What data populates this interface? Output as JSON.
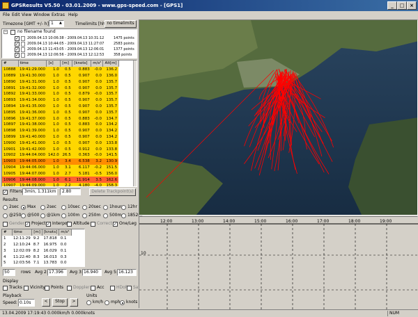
{
  "window": {
    "title": "GPSResults V5.50 - 03.01.2009 - www.gps-speed.com - [GPS1]",
    "min": "_",
    "max": "□",
    "close": "×"
  },
  "menubar": [
    "File",
    "Edit",
    "View",
    "Window",
    "Extras",
    "Help"
  ],
  "timezone": {
    "label": "Timezone [GMT +/- h]:",
    "value": "1",
    "timelimits_label": "Timelimits [hhmm]",
    "timelimits_button": "no timelimits"
  },
  "tracks": {
    "root": "no filename found",
    "items": [
      {
        "label": "2009.04.13 10:06:38 - 2009.04.13 10:31:12",
        "points": "1475 points"
      },
      {
        "label": "2009.04.13 10:44:05 - 2009.04.13 11:27:07",
        "points": "2583 points"
      },
      {
        "label": "2009.04.13 11:43:05 - 2009.04.13 12:06:01",
        "points": "1377 points"
      },
      {
        "label": "2009.04.13 12:06:56 - 2009.04.13 12:12:53",
        "points": "358 points"
      }
    ]
  },
  "points_table": {
    "headers": [
      "#",
      "time",
      "[s]",
      "[m]",
      "[knots]",
      "m/s²",
      "Alt[m]"
    ],
    "rows": [
      [
        "10888",
        "19:41:29.000",
        "1.0",
        "0.5",
        "0.883",
        "-0.0",
        "136.2"
      ],
      [
        "10889",
        "19:41:30.000",
        "1.0",
        "0.5",
        "0.907",
        "0.0",
        "136.0"
      ],
      [
        "10890",
        "19:41:31.000",
        "1.0",
        "0.5",
        "0.907",
        "0.0",
        "135.7"
      ],
      [
        "10891",
        "19:41:32.000",
        "1.0",
        "0.5",
        "0.907",
        "0.0",
        "135.7"
      ],
      [
        "10892",
        "19:41:33.000",
        "1.0",
        "0.5",
        "0.879",
        "-0.0",
        "135.7"
      ],
      [
        "10893",
        "19:41:34.000",
        "1.0",
        "0.5",
        "0.907",
        "0.0",
        "135.7"
      ],
      [
        "10894",
        "19:41:35.000",
        "1.0",
        "0.5",
        "0.907",
        "0.0",
        "135.7"
      ],
      [
        "10895",
        "19:41:36.000",
        "1.0",
        "0.5",
        "0.907",
        "0.0",
        "135.7"
      ],
      [
        "10896",
        "19:41:37.000",
        "1.0",
        "0.5",
        "0.883",
        "-0.0",
        "134.7"
      ],
      [
        "10897",
        "19:41:38.000",
        "1.0",
        "0.5",
        "0.883",
        "0.0",
        "134.2"
      ],
      [
        "10898",
        "19:41:39.000",
        "1.0",
        "0.5",
        "0.907",
        "0.0",
        "134.2"
      ],
      [
        "10899",
        "19:41:40.000",
        "1.0",
        "0.5",
        "0.907",
        "0.0",
        "134.2"
      ],
      [
        "10900",
        "19:41:41.000",
        "1.0",
        "0.5",
        "0.907",
        "0.0",
        "133.8"
      ],
      [
        "10901",
        "19:41:42.000",
        "1.0",
        "0.5",
        "0.912",
        "0.0",
        "133.8"
      ],
      [
        "10902",
        "19:44:04.000",
        "142.0",
        "26.5",
        "0.363",
        "-0.0",
        "141.5"
      ],
      [
        "10903",
        "19:44:05.000",
        "1.0",
        "3.4",
        "6.538",
        "3.2",
        "130.9"
      ],
      [
        "10904",
        "19:44:06.000",
        "1.0",
        "3.1",
        "6.117",
        "-0.2",
        "151.5"
      ],
      [
        "10905",
        "19:44:07.000",
        "1.0",
        "2.7",
        "5.181",
        "-0.5",
        "156.0"
      ],
      [
        "10906",
        "19:44:08.000",
        "1.0",
        "6.1",
        "11.914",
        "3.5",
        "162.6"
      ],
      [
        "10907",
        "19:44:09.000",
        "1.0",
        "2.2",
        "4.180",
        "-4.0",
        "158.3"
      ]
    ],
    "row_colors": [
      "#ffd700",
      "#ffd700",
      "#ffd700",
      "#ffd700",
      "#ffd700",
      "#ffd700",
      "#ffd700",
      "#ffd700",
      "#ffd700",
      "#ffd700",
      "#ffd700",
      "#ffd700",
      "#ffd700",
      "#ffd700",
      "#ffd700",
      "#ff8c00",
      "#ffd700",
      "#ffd700",
      "#ff6030",
      "#ffd700"
    ]
  },
  "filters": {
    "label": "Filters",
    "value1": "3min, 1.311km",
    "value2": "2.80",
    "delete_button": "Delete Trackpoint(s)"
  },
  "results": {
    "label": "Results",
    "row1": [
      "2sec",
      "Max",
      "2sec",
      "10sec",
      "20sec",
      "1hour",
      "12hr"
    ],
    "row2": [
      "@250",
      "@500",
      "@1km",
      "100m",
      "250m",
      "500m",
      "1852m"
    ],
    "row3": [
      "Gender",
      "Project",
      "Interpol",
      "Altitude",
      "Correct",
      "One/Leg"
    ],
    "table_headers": [
      "#",
      "time",
      "[m]",
      "[knots]",
      "m/s²"
    ],
    "table_rows": [
      [
        "1",
        "12:11:29",
        "9.2",
        "17.818",
        "0.1"
      ],
      [
        "2",
        "12:10:24",
        "8.7",
        "16.975",
        "0.0"
      ],
      [
        "3",
        "12:02:09",
        "8.2",
        "16.029",
        "0.1"
      ],
      [
        "4",
        "11:22:40",
        "8.3",
        "16.013",
        "0.3"
      ],
      [
        "5",
        "12:03:56",
        "7.1",
        "13.783",
        "0.0"
      ]
    ],
    "rows_value": "50",
    "rows_label": "rows",
    "avg2_label": "Avg 2:",
    "avg2": "17.396",
    "avg3_label": "Avg 3:",
    "avg3": "16.940",
    "avg5_label": "Avg 5:",
    "avg5": "16.123"
  },
  "display": {
    "label": "Display",
    "items": [
      "Tracks",
      "Vicinity",
      "Points",
      "Doppler",
      "Acc",
      "HDoP",
      "Sats"
    ]
  },
  "playback": {
    "label": "Playback",
    "speed_label": "Speed:",
    "speed_value": "0.10s",
    "prev": "<",
    "stop": "Stop",
    "next": ">"
  },
  "units": {
    "label": "Units",
    "options": [
      "km/h",
      "mph",
      "knots"
    ]
  },
  "timeline": {
    "ticks": [
      "12:00",
      "13:00",
      "14:00",
      "15:00",
      "16:00",
      "17:00",
      "18:00",
      "19:00"
    ],
    "y_label": "10"
  },
  "status": {
    "text": "13.04.2009 17:19:43  0.000km/h  0.000knots",
    "num": "NUM"
  },
  "colors": {
    "track": "#ff0000",
    "water": "#1d3550",
    "row_yellow": "#ffd700",
    "row_orange": "#ff8c00",
    "row_red": "#ff6030"
  }
}
